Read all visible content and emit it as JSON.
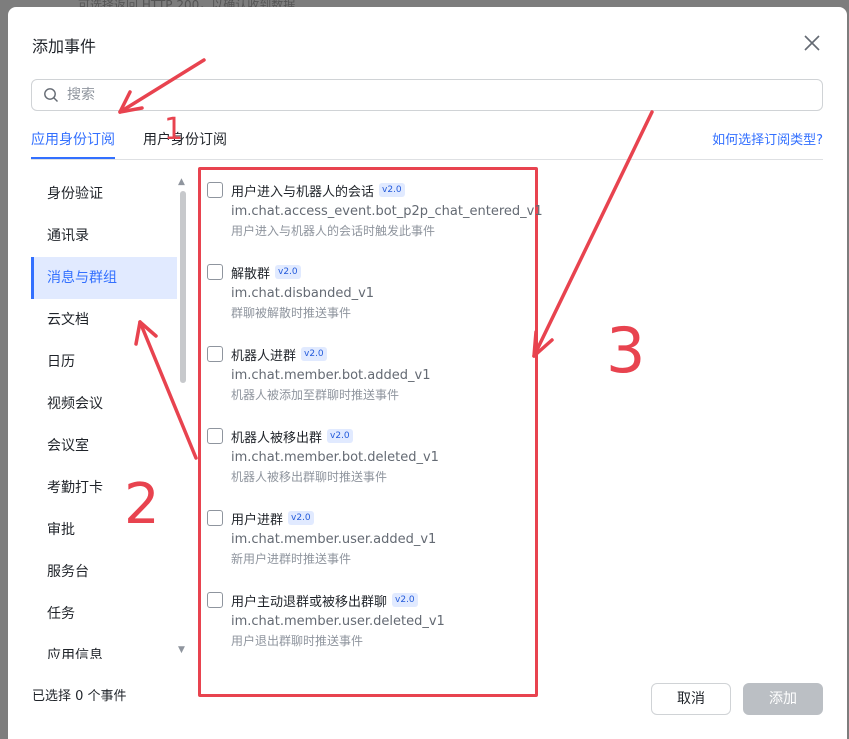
{
  "background": {
    "top_text": "可选择返回 HTTP 200，以确认收到数据"
  },
  "dialog": {
    "title": "添加事件",
    "close_icon": "close-icon"
  },
  "search": {
    "placeholder": "搜索",
    "value": "",
    "icon": "search-icon"
  },
  "tabs": {
    "items": [
      {
        "label": "应用身份订阅",
        "active": true
      },
      {
        "label": "用户身份订阅",
        "active": false
      }
    ],
    "help_link": "如何选择订阅类型?"
  },
  "sidebar": {
    "items": [
      {
        "label": "身份验证",
        "active": false
      },
      {
        "label": "通讯录",
        "active": false
      },
      {
        "label": "消息与群组",
        "active": true
      },
      {
        "label": "云文档",
        "active": false
      },
      {
        "label": "日历",
        "active": false
      },
      {
        "label": "视频会议",
        "active": false
      },
      {
        "label": "会议室",
        "active": false
      },
      {
        "label": "考勤打卡",
        "active": false
      },
      {
        "label": "审批",
        "active": false
      },
      {
        "label": "服务台",
        "active": false
      },
      {
        "label": "任务",
        "active": false
      },
      {
        "label": "应用信息",
        "active": false
      }
    ]
  },
  "events": [
    {
      "title": "用户进入与机器人的会话",
      "badge": "v2.0",
      "key": "im.chat.access_event.bot_p2p_chat_entered_v1",
      "desc": "用户进入与机器人的会话时触发此事件",
      "checked": false
    },
    {
      "title": "解散群",
      "badge": "v2.0",
      "key": "im.chat.disbanded_v1",
      "desc": "群聊被解散时推送事件",
      "checked": false
    },
    {
      "title": "机器人进群",
      "badge": "v2.0",
      "key": "im.chat.member.bot.added_v1",
      "desc": "机器人被添加至群聊时推送事件",
      "checked": false
    },
    {
      "title": "机器人被移出群",
      "badge": "v2.0",
      "key": "im.chat.member.bot.deleted_v1",
      "desc": "机器人被移出群聊时推送事件",
      "checked": false
    },
    {
      "title": "用户进群",
      "badge": "v2.0",
      "key": "im.chat.member.user.added_v1",
      "desc": "新用户进群时推送事件",
      "checked": false
    },
    {
      "title": "用户主动退群或被移出群聊",
      "badge": "v2.0",
      "key": "im.chat.member.user.deleted_v1",
      "desc": "用户退出群聊时推送事件",
      "checked": false
    }
  ],
  "footer": {
    "selected_text": "已选择 0 个事件",
    "cancel_label": "取消",
    "add_label": "添加"
  },
  "annotations": {
    "labels": [
      "1",
      "2",
      "3"
    ],
    "color": "#e8434f"
  },
  "colors": {
    "accent": "#3370ff",
    "annotation_red": "#e8434f"
  }
}
